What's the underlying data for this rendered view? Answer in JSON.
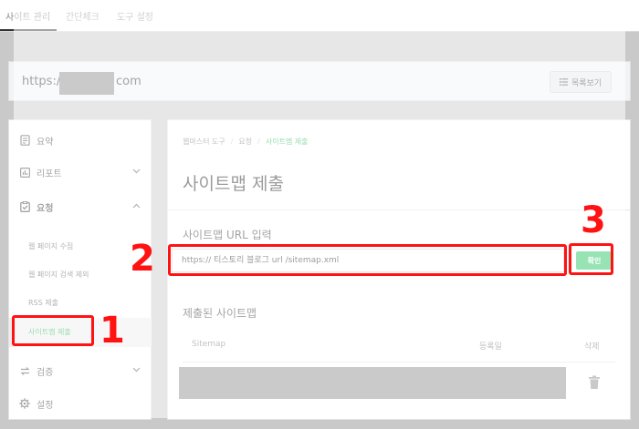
{
  "tabs": [
    {
      "label": "사이트 관리",
      "active": true
    },
    {
      "label": "간단체크",
      "active": false
    },
    {
      "label": "도구 설정",
      "active": false
    }
  ],
  "site": {
    "url_prefix": "https://",
    "url_suffix": "com",
    "list_button": "목록보기"
  },
  "sidebar": {
    "items": [
      {
        "label": "요약",
        "icon": "document-icon"
      },
      {
        "label": "리포트",
        "icon": "bar-chart-icon",
        "chevron": "down"
      },
      {
        "label": "요청",
        "icon": "clipboard-check-icon",
        "chevron": "up"
      },
      {
        "label": "검증",
        "icon": "swap-icon",
        "chevron": "down"
      },
      {
        "label": "설정",
        "icon": "gear-icon"
      }
    ],
    "sub_items": [
      "웹 페이지 수집",
      "웹 페이지 검색 제외",
      "RSS 제출",
      "사이트맵 제출"
    ],
    "selected_sub": "사이트맵 제출"
  },
  "breadcrumb": [
    "웹마스터 도구",
    "요청",
    "사이트맵 제출"
  ],
  "main": {
    "title": "사이트맵 제출",
    "input_label": "사이트맵 URL 입력",
    "input_value": "https:// 티스토리 블로그 url /sitemap.xml",
    "confirm_label": "확인",
    "submitted_label": "제출된 사이트맵",
    "table_headers": [
      "Sitemap",
      "등록일",
      "삭제"
    ]
  },
  "annotations": [
    "1",
    "2",
    "3"
  ],
  "colors": {
    "accent": "#17b150",
    "annotation": "#ff1212",
    "confirm": "#19c25a"
  }
}
